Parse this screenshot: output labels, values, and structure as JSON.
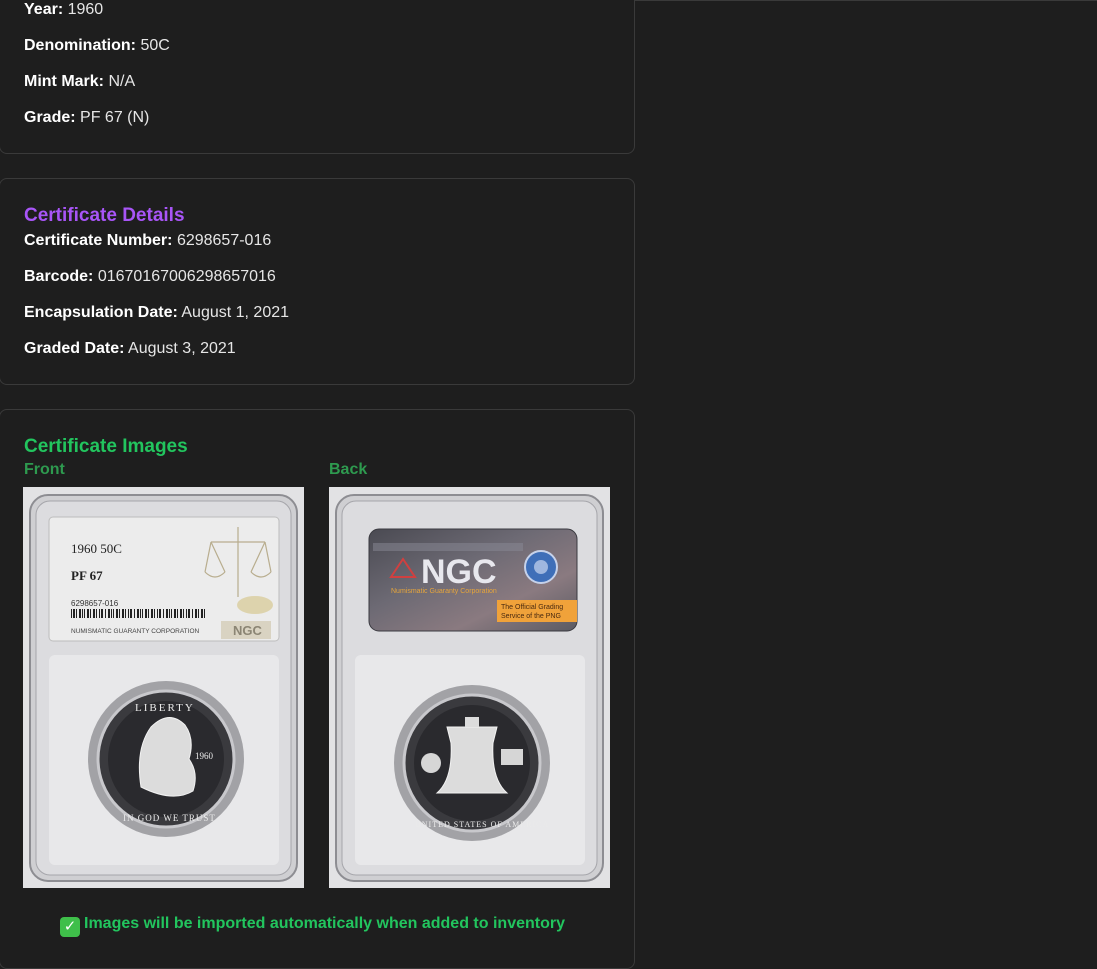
{
  "coin_info": {
    "year": {
      "label": "Year:",
      "value": "1960"
    },
    "denomination": {
      "label": "Denomination:",
      "value": "50C"
    },
    "mint_mark": {
      "label": "Mint Mark:",
      "value": "N/A"
    },
    "grade": {
      "label": "Grade:",
      "value": "PF 67 (N)"
    }
  },
  "certificate": {
    "title": "Certificate Details",
    "number": {
      "label": "Certificate Number:",
      "value": "6298657-016"
    },
    "barcode": {
      "label": "Barcode:",
      "value": "01670167006298657016"
    },
    "encapsulation_date": {
      "label": "Encapsulation Date:",
      "value": "August 1, 2021"
    },
    "graded_date": {
      "label": "Graded Date:",
      "value": "August 3, 2021"
    }
  },
  "images": {
    "title": "Certificate Images",
    "front_label": "Front",
    "back_label": "Back",
    "front_slab": {
      "year_denom": "1960  50C",
      "grade": "PF 67",
      "cert": "6298657-016",
      "corp": "NUMISMATIC GUARANTY CORPORATION",
      "brand": "NGC",
      "legend_top": "LIBERTY",
      "legend_bottom": "IN GOD WE TRUST",
      "coin_date": "1960"
    },
    "back_slab": {
      "brand": "NGC",
      "corp": "Numismatic Guaranty Corporation",
      "tagline1": "The Official Grading",
      "tagline2": "Service of the PNG",
      "legend": "UNITED STATES OF AMERICA"
    },
    "notice_icon": "check-mark-icon",
    "notice": "Images will be imported automatically when added to inventory"
  },
  "colors": {
    "background": "#1e1e1e",
    "border": "#3a3a3a",
    "purple_title": "#a855f7",
    "green_title": "#22c55e"
  }
}
